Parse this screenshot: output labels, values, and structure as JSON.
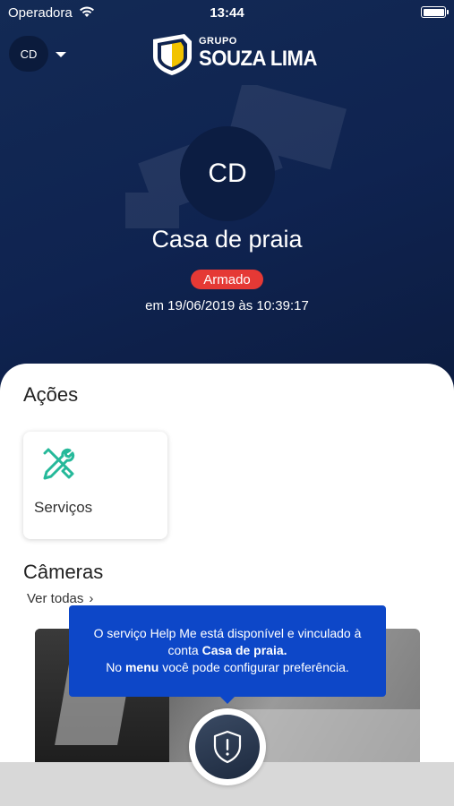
{
  "status_bar": {
    "carrier": "Operadora",
    "time": "13:44"
  },
  "header": {
    "user_initials": "CD",
    "logo_top": "GRUPO",
    "logo_name": "SOUZA LIMA"
  },
  "place": {
    "initials": "CD",
    "name": "Casa de praia",
    "status": "Armado",
    "status_color": "#e53935",
    "timestamp": "em 19/06/2019 às 10:39:17"
  },
  "actions": {
    "title": "Ações",
    "items": [
      {
        "label": "Serviços",
        "icon": "tools-icon",
        "icon_color": "#26b99a"
      }
    ]
  },
  "cameras": {
    "title": "Câmeras",
    "see_all": "Ver todas"
  },
  "tooltip": {
    "line1": "O serviço Help Me está disponível e vinculado à",
    "line2_prefix": "conta ",
    "line2_bold": "Casa de praia.",
    "line3_prefix": "No ",
    "line3_bold": "menu",
    "line3_suffix": " você pode configurar preferência."
  },
  "help_button": {
    "icon": "shield-alert-icon"
  },
  "colors": {
    "header_bg": "#132a55",
    "tooltip_bg": "#0d47c8",
    "accent": "#26b99a"
  }
}
